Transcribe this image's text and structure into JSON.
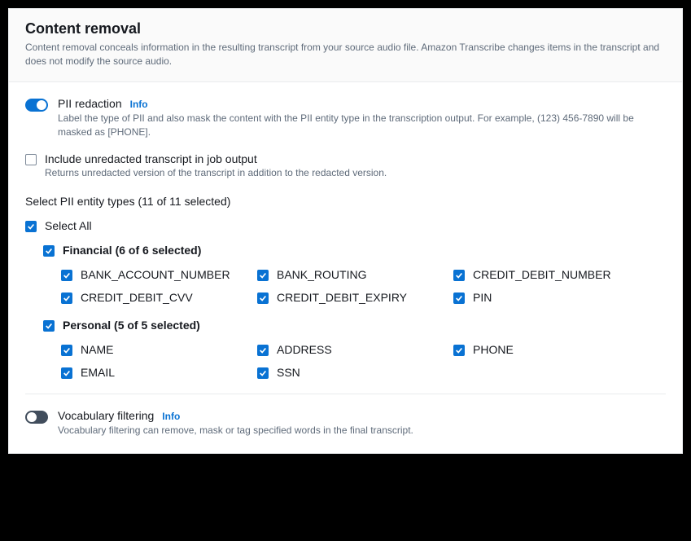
{
  "header": {
    "title": "Content removal",
    "description": "Content removal conceals information in the resulting transcript from your source audio file. Amazon Transcribe changes items in the transcript and does not modify the source audio."
  },
  "pii_redaction": {
    "label": "PII redaction",
    "info": "Info",
    "description": "Label the type of PII and also mask the content with the PII entity type in the transcription output. For example, (123) 456-7890 will be masked as [PHONE]."
  },
  "include_unredacted": {
    "label": "Include unredacted transcript in job output",
    "description": "Returns unredacted version of the transcript in addition to the redacted version."
  },
  "entity_section": {
    "heading": "Select PII entity types (11 of 11 selected)",
    "select_all": "Select All",
    "financial": {
      "label": "Financial (6 of 6 selected)",
      "items": [
        "BANK_ACCOUNT_NUMBER",
        "BANK_ROUTING",
        "CREDIT_DEBIT_NUMBER",
        "CREDIT_DEBIT_CVV",
        "CREDIT_DEBIT_EXPIRY",
        "PIN"
      ]
    },
    "personal": {
      "label": "Personal (5 of 5 selected)",
      "items": [
        "NAME",
        "ADDRESS",
        "PHONE",
        "EMAIL",
        "SSN"
      ]
    }
  },
  "vocab_filtering": {
    "label": "Vocabulary filtering",
    "info": "Info",
    "description": "Vocabulary filtering can remove, mask or tag specified words in the final transcript."
  }
}
